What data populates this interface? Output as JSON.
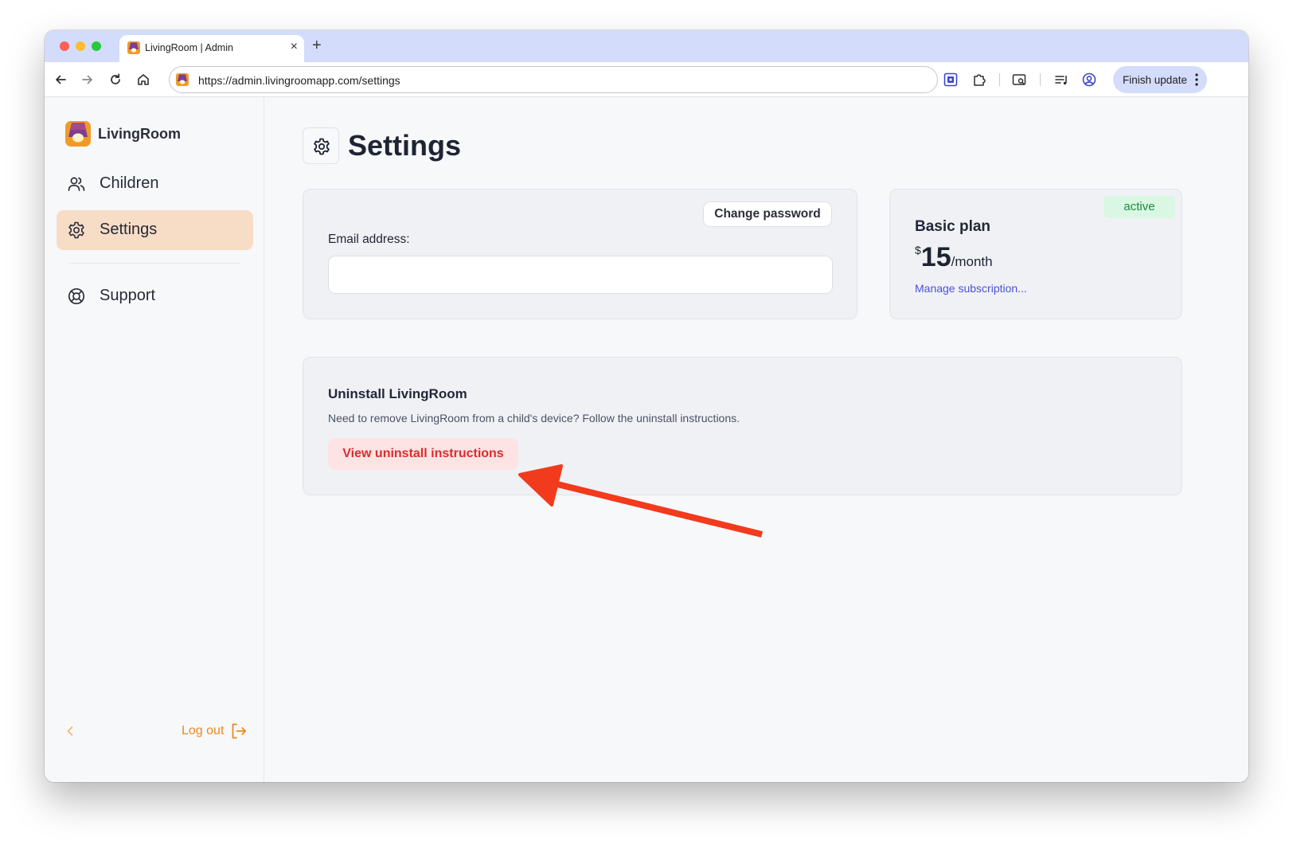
{
  "browser": {
    "tab_title": "LivingRoom | Admin",
    "new_tab_label": "+",
    "tab_close_label": "×",
    "url": "https://admin.livingroomapp.com/settings",
    "finish_update_label": "Finish update"
  },
  "sidebar": {
    "brand": "LivingRoom",
    "items": [
      {
        "label": "Children",
        "icon": "users-icon",
        "active": false
      },
      {
        "label": "Settings",
        "icon": "gear-icon",
        "active": true
      },
      {
        "label": "Support",
        "icon": "lifebuoy-icon",
        "active": false
      }
    ],
    "logout_label": "Log out"
  },
  "main": {
    "title": "Settings",
    "account": {
      "change_password_label": "Change password",
      "email_label": "Email address:",
      "email_value": ""
    },
    "plan": {
      "status": "active",
      "name": "Basic plan",
      "currency": "$",
      "amount": "15",
      "period": "/month",
      "manage_label": "Manage subscription..."
    },
    "uninstall": {
      "title": "Uninstall LivingRoom",
      "description": "Need to remove LivingRoom from a child's device? Follow the uninstall instructions.",
      "button_label": "View uninstall instructions"
    }
  },
  "colors": {
    "accent": "#ea8a1f",
    "sidebar_active_bg": "#f7dcc6",
    "danger": "#d92d2d",
    "danger_bg": "#fde3e3",
    "success": "#1e8a3e",
    "link": "#4b51d8",
    "annotation_arrow": "#f23a1c"
  }
}
